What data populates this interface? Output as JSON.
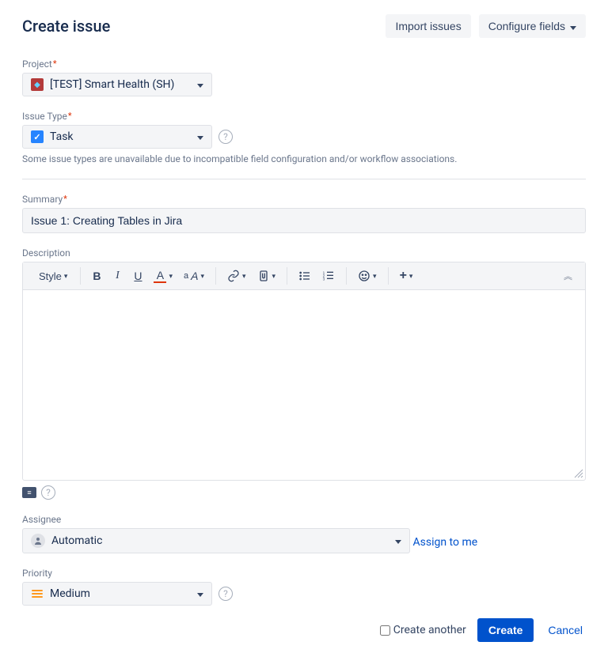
{
  "header": {
    "title": "Create issue",
    "import_label": "Import issues",
    "configure_label": "Configure fields"
  },
  "project": {
    "label": "Project",
    "value": "[TEST] Smart Health (SH)"
  },
  "issue_type": {
    "label": "Issue Type",
    "value": "Task",
    "hint": "Some issue types are unavailable due to incompatible field configuration and/or workflow associations."
  },
  "summary": {
    "label": "Summary",
    "value": "Issue 1: Creating Tables in Jira"
  },
  "description": {
    "label": "Description",
    "toolbar": {
      "style_label": "Style"
    }
  },
  "assignee": {
    "label": "Assignee",
    "value": "Automatic",
    "assign_to_me": "Assign to me"
  },
  "priority": {
    "label": "Priority",
    "value": "Medium"
  },
  "footer": {
    "create_another": "Create another",
    "create": "Create",
    "cancel": "Cancel"
  }
}
